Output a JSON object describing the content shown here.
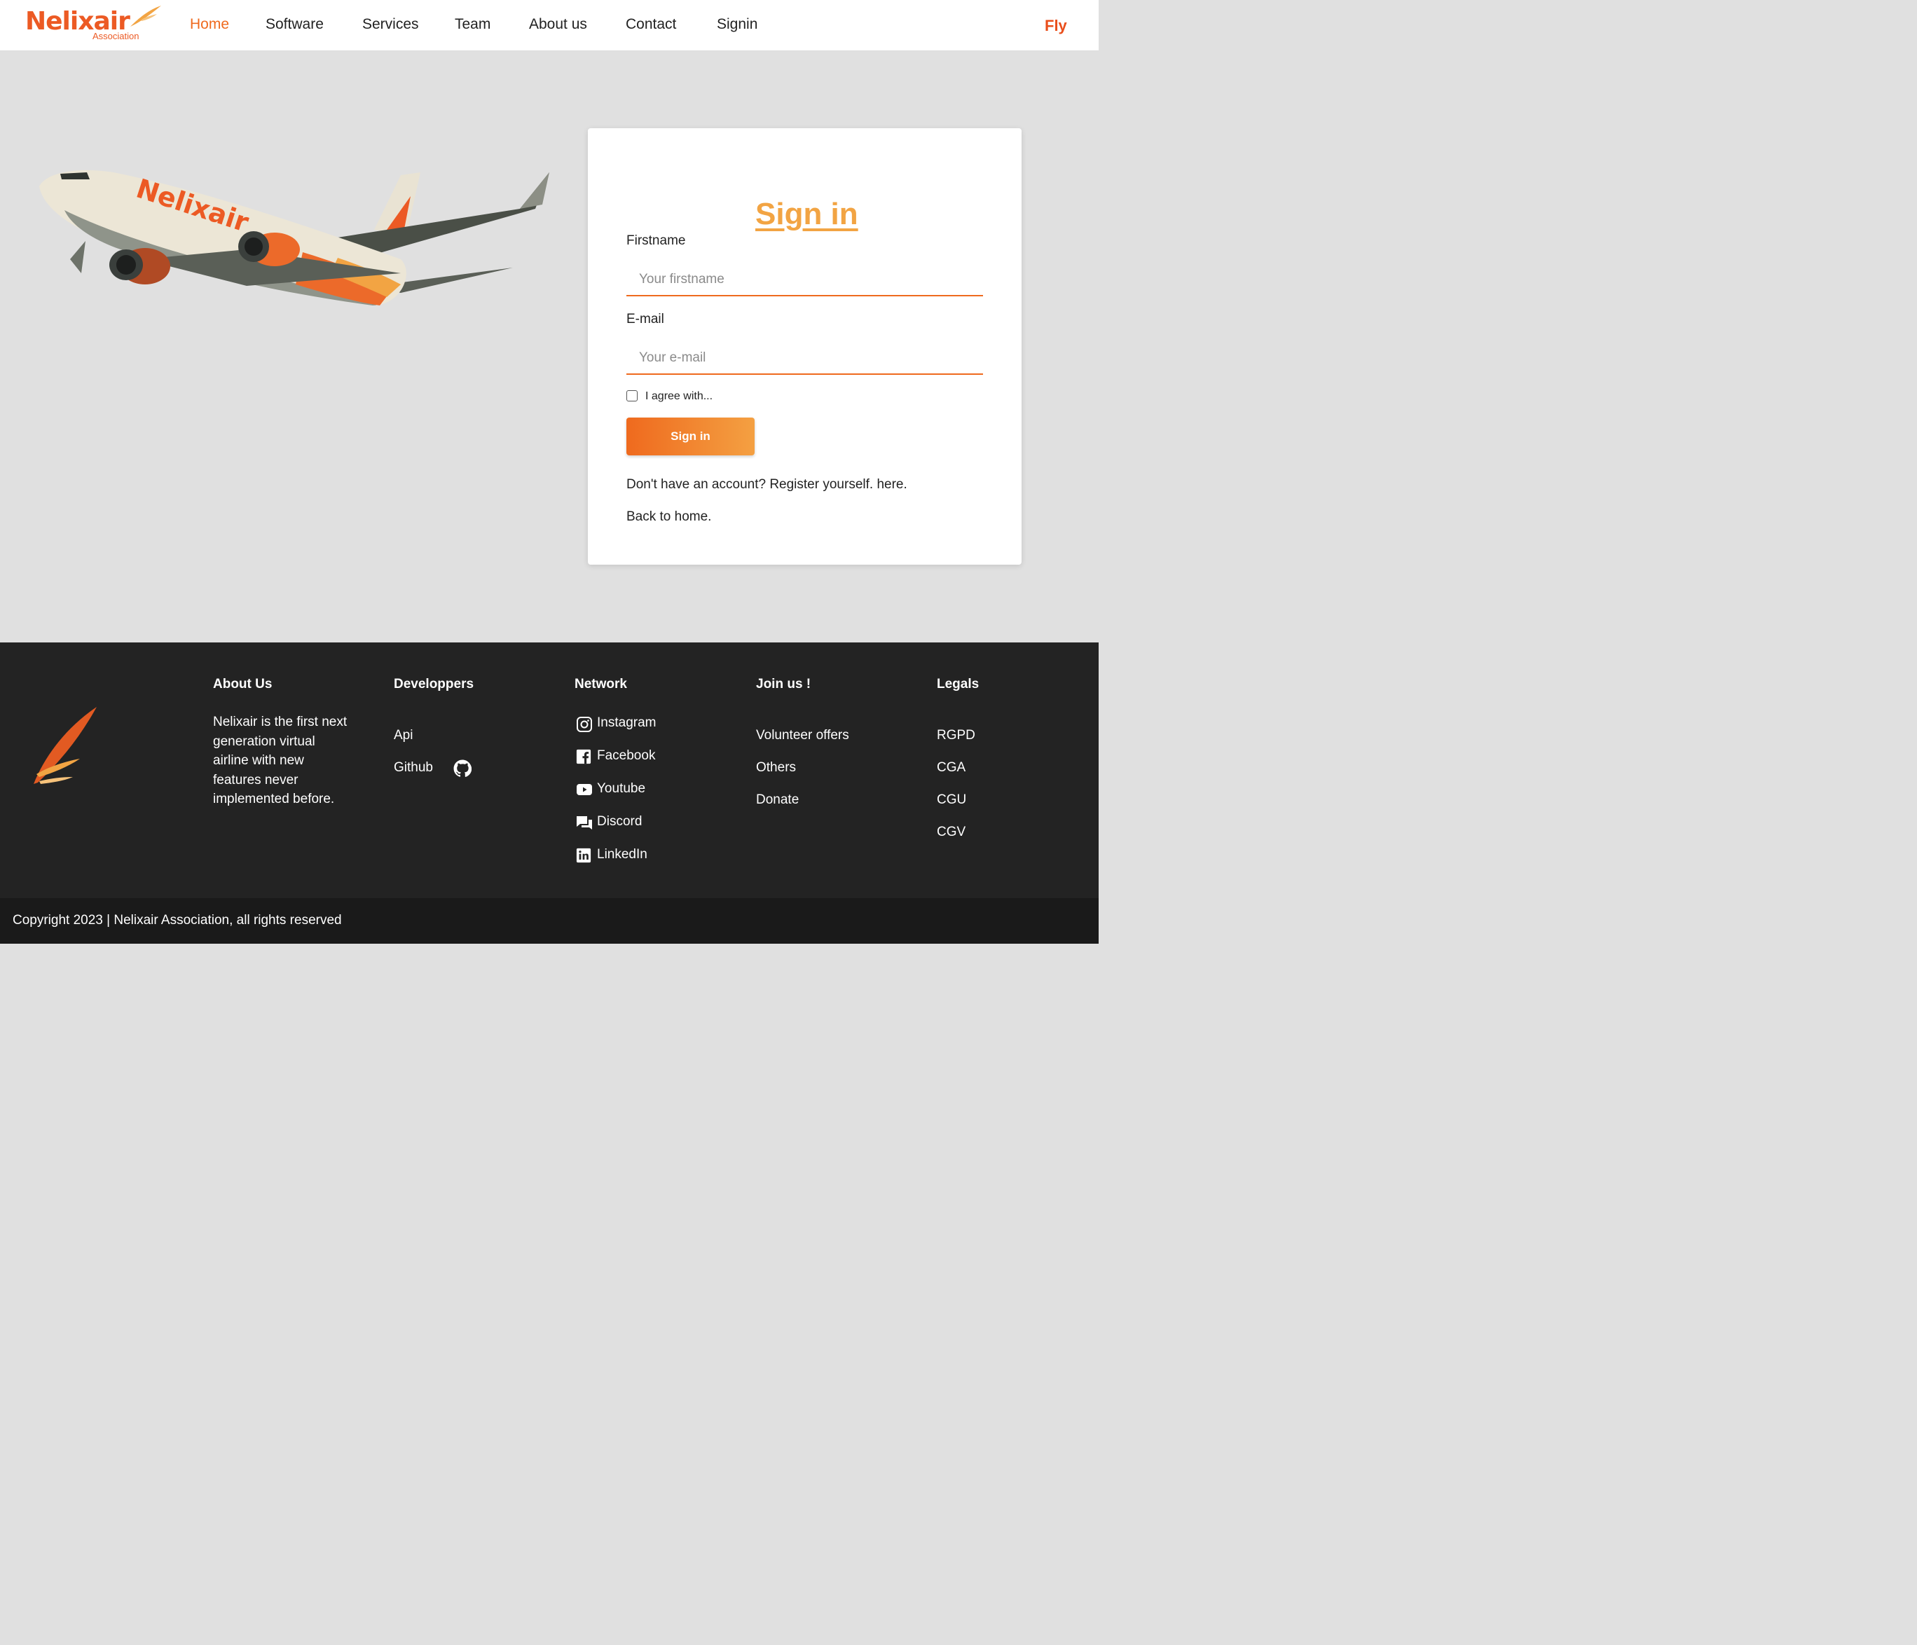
{
  "brand": {
    "name": "Nelixair",
    "tagline": "Association",
    "accent": "#ec5a24"
  },
  "nav": {
    "items": [
      "Home",
      "Software",
      "Services",
      "Team",
      "About us",
      "Contact",
      "Signin"
    ],
    "active": "Home",
    "fly": "Fly"
  },
  "hero": {
    "plane_livery": "Nelixair"
  },
  "signin": {
    "title": "Sign in",
    "firstname_label": "Firstname",
    "firstname_placeholder": "Your firstname",
    "email_label": "E-mail",
    "email_placeholder": "Your e-mail",
    "agree_label": "I agree with...",
    "agree_checked": false,
    "button": "Sign in",
    "register_text": "Don't have an account? Register yourself. here.",
    "home_text": "Back to home."
  },
  "footer": {
    "about": {
      "heading": "About Us",
      "text": "Nelixair is the first next generation virtual airline with new features never implemented before."
    },
    "developers": {
      "heading": "Developpers",
      "links": [
        "Api",
        "Github"
      ]
    },
    "network": {
      "heading": "Network",
      "links": [
        {
          "label": "Instagram",
          "icon": "instagram-icon"
        },
        {
          "label": "Facebook",
          "icon": "facebook-icon"
        },
        {
          "label": "Youtube",
          "icon": "youtube-icon"
        },
        {
          "label": "Discord",
          "icon": "discord-icon"
        },
        {
          "label": "LinkedIn",
          "icon": "linkedin-icon"
        }
      ]
    },
    "join": {
      "heading": "Join us !",
      "links": [
        "Volunteer offers",
        "Others",
        "Donate"
      ]
    },
    "legals": {
      "heading": "Legals",
      "links": [
        "RGPD",
        "CGA",
        "CGU",
        "CGV"
      ]
    }
  },
  "copyright": "Copyright 2023 | Nelixair Association, all rights reserved",
  "colors": {
    "orange": "#ef6a1e",
    "title_orange": "#f2a443",
    "footer_bg": "#232323",
    "page_bg": "#e0e0e0"
  }
}
